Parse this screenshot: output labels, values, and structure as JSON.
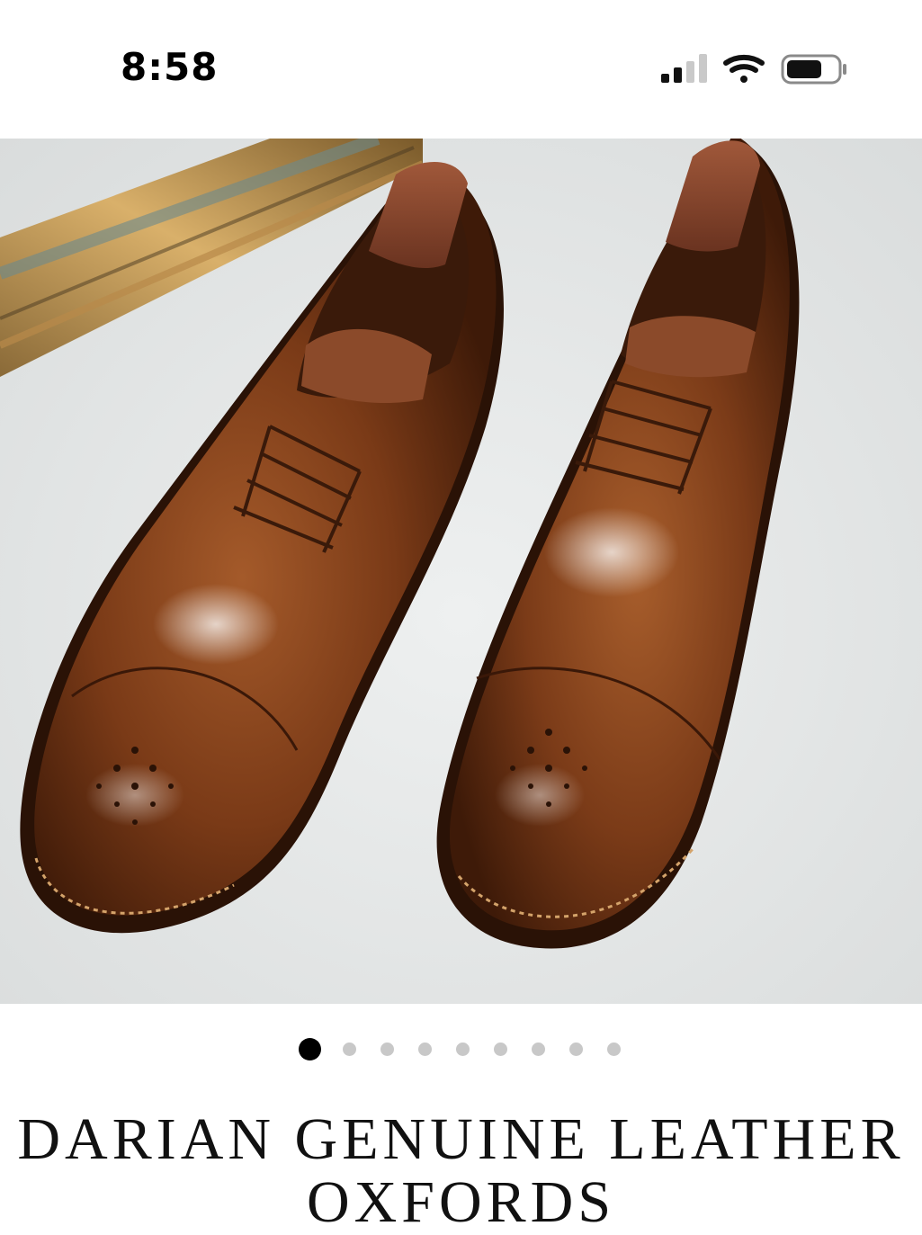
{
  "status_bar": {
    "time": "8:58"
  },
  "product": {
    "title": "DARIAN GENUINE LEATHER OXFORDS",
    "image_alt": "Brown leather cap-toe oxford shoes with wooden shoe trees",
    "gallery_count": 9,
    "gallery_active_index": 0
  },
  "icons": {
    "signal": "cellular-signal-icon",
    "wifi": "wifi-icon",
    "battery": "battery-icon",
    "zoom": "search-icon"
  },
  "colors": {
    "leather": "#6e3315",
    "background": "#e6e8e8",
    "dot_active": "#000000",
    "dot_inactive": "#c8c8c8"
  }
}
